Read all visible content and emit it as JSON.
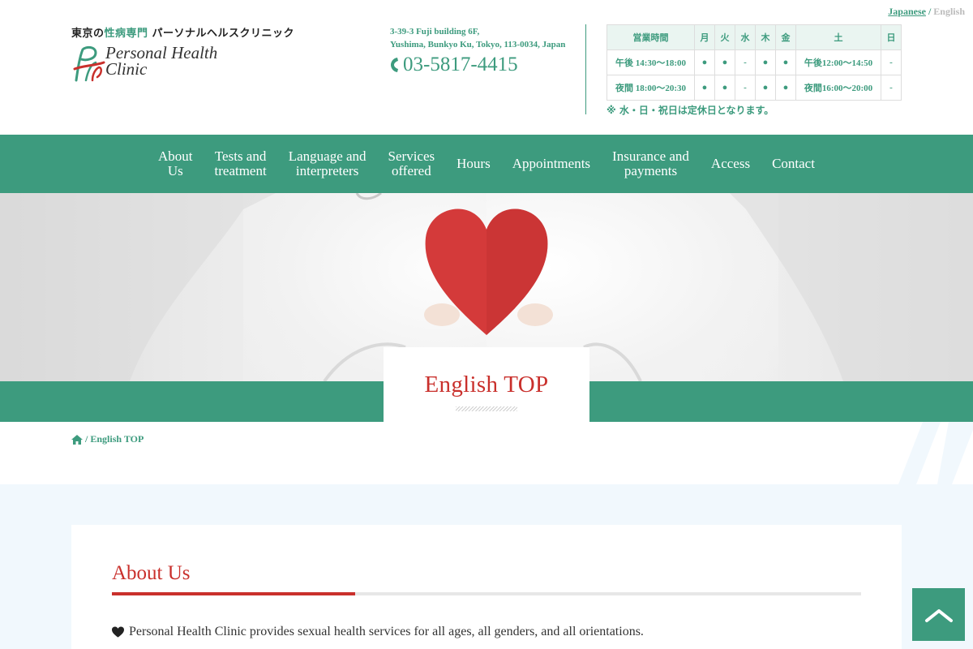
{
  "language_switch": {
    "japanese": "Japanese",
    "separator": "/",
    "english": "English"
  },
  "header": {
    "tagline_prefix": "東京の",
    "tagline_highlight": "性病専門",
    "tagline_suffix": " パーソナルヘルスクリニック",
    "logo_line1": "Personal Health",
    "logo_line2": "Clinic",
    "address_line1": "3-39-3 Fuji building 6F,",
    "address_line2": "Yushima, Bunkyo Ku, Tokyo, 113-0034, Japan",
    "phone": "03-5817-4415"
  },
  "hours_table": {
    "header": [
      "営業時間",
      "月",
      "火",
      "水",
      "木",
      "金",
      "土",
      "日"
    ],
    "rows": [
      [
        "午後 14:30〜18:00",
        "●",
        "●",
        "-",
        "●",
        "●",
        "午後12:00〜14:50",
        "-"
      ],
      [
        "夜間 18:00〜20:30",
        "●",
        "●",
        "-",
        "●",
        "●",
        "夜間16:00〜20:00",
        "-"
      ]
    ],
    "note": "※ 水・日・祝日は定休日となります。"
  },
  "nav": [
    {
      "line1": "About",
      "line2": "Us"
    },
    {
      "line1": "Tests and",
      "line2": "treatment"
    },
    {
      "line1": "Language and",
      "line2": "interpreters"
    },
    {
      "line1": "Services",
      "line2": "offered"
    },
    {
      "line1": "Hours",
      "line2": ""
    },
    {
      "line1": "Appointments",
      "line2": ""
    },
    {
      "line1": "Insurance and",
      "line2": "payments"
    },
    {
      "line1": "Access",
      "line2": ""
    },
    {
      "line1": "Contact",
      "line2": ""
    }
  ],
  "page_title": "English TOP",
  "breadcrumb": {
    "separator": "/",
    "current": "English TOP"
  },
  "about": {
    "heading": "About Us",
    "text": "Personal Health Clinic provides sexual health services for all ages, all genders, and all orientations."
  },
  "colors": {
    "brand_green": "#3d9b7e",
    "accent_red": "#c9302c",
    "content_bg": "#f1f8fd"
  },
  "icons": {
    "phone": "phone-icon",
    "home": "home-icon",
    "heart": "heart-icon",
    "to_top": "chevron-up-icon"
  }
}
